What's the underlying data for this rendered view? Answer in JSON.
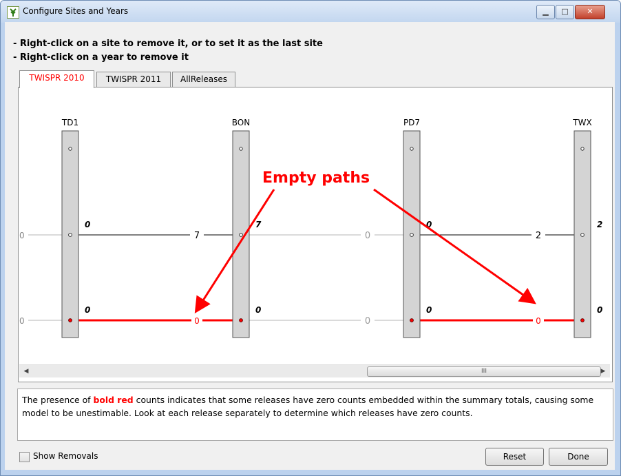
{
  "window": {
    "title": "Configure Sites and Years"
  },
  "instructions": [
    "- Right-click on a site to remove it, or to set it as the last site",
    "- Right-click on a year to remove it"
  ],
  "tabs": [
    {
      "label": "TWISPR 2010",
      "active": true
    },
    {
      "label": "TWISPR 2011",
      "active": false
    },
    {
      "label": "AllReleases",
      "active": false
    }
  ],
  "diagram": {
    "sites": [
      "TD1",
      "BON",
      "PD7",
      "TWX"
    ],
    "rows": [
      {
        "row_label": "0",
        "edges": [
          {
            "count": "7",
            "zero": false
          },
          {
            "count": "0",
            "zero": false
          },
          {
            "count": "2",
            "zero": false
          }
        ],
        "site_counts": [
          "0",
          "7",
          "0",
          "2"
        ]
      },
      {
        "row_label": "0",
        "edges": [
          {
            "count": "0",
            "zero": true
          },
          {
            "count": "0",
            "zero": false
          },
          {
            "count": "0",
            "zero": true
          }
        ],
        "site_counts": [
          "0",
          "0",
          "0",
          "0"
        ]
      }
    ],
    "annotation": "Empty paths",
    "colors": {
      "highlight": "#ff0000",
      "bar": "#d4d4d4",
      "gray_line": "#b4b4b4"
    }
  },
  "scrollbar": {
    "left_arrow": "◀",
    "right_arrow": "▶",
    "grip": "III"
  },
  "description": {
    "before": "The presence of ",
    "bold": "bold red",
    "after": " counts indicates that some releases have zero counts embedded within the summary totals, causing some model to be unestimable. Look at each release separately to determine which releases have zero counts."
  },
  "footer": {
    "show_removals_label": "Show Removals",
    "show_removals_checked": false,
    "reset_label": "Reset",
    "done_label": "Done"
  }
}
